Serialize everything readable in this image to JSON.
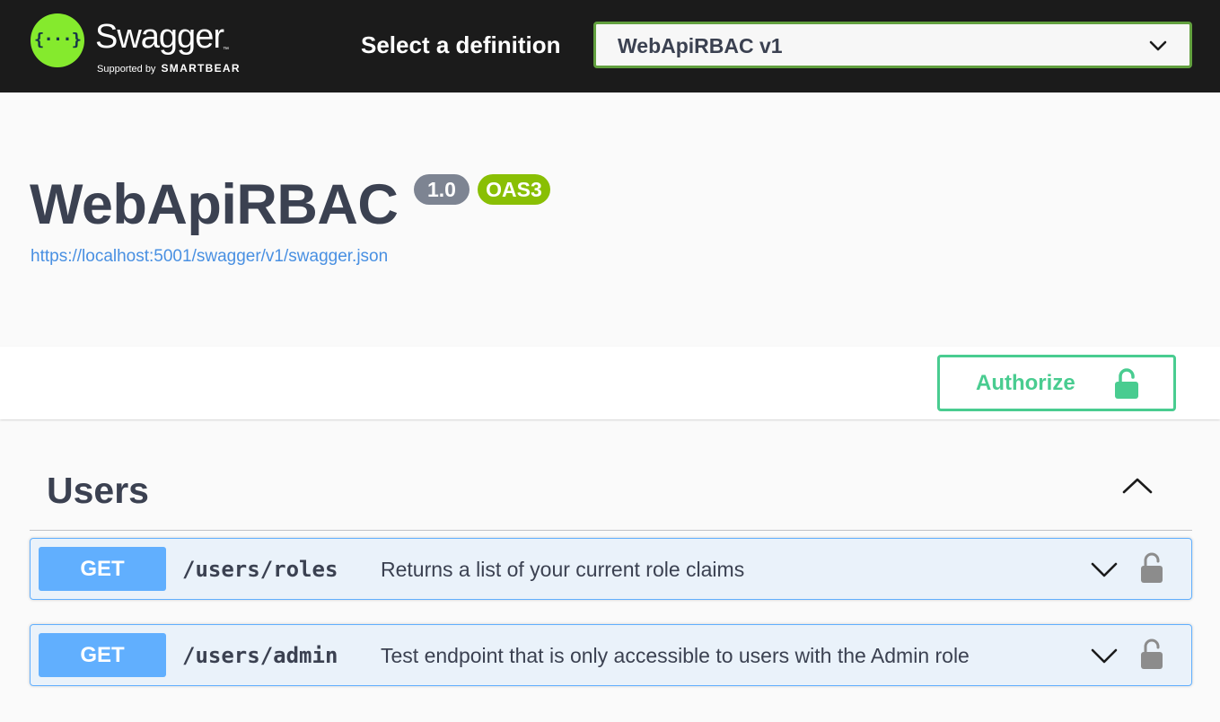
{
  "topbar": {
    "logo_title": "Swagger",
    "logo_tm": "™",
    "logo_braces": "{···}",
    "logo_supported_by": "Supported by",
    "logo_company": "SMARTBEAR",
    "definition_label": "Select a definition",
    "definition_selected": "WebApiRBAC v1"
  },
  "info": {
    "title": "WebApiRBAC",
    "version_badge": "1.0",
    "oas_badge": "OAS3",
    "spec_url": "https://localhost:5001/swagger/v1/swagger.json"
  },
  "auth": {
    "authorize_label": "Authorize"
  },
  "tags": [
    {
      "name": "Users",
      "expanded": true,
      "operations": [
        {
          "method": "GET",
          "path": "/users/roles",
          "summary": "Returns a list of your current role claims",
          "locked": false
        },
        {
          "method": "GET",
          "path": "/users/admin",
          "summary": "Test endpoint that is only accessible to users with the Admin role",
          "locked": false
        }
      ]
    }
  ],
  "colors": {
    "topbar_bg": "#1b1b1b",
    "logo_green": "#85ea2d",
    "select_border": "#62a03f",
    "authorize_green": "#49cc90",
    "get_blue": "#61affe",
    "version_badge": "#7d8492",
    "oas_badge": "#89bf04",
    "link_blue": "#4990e2"
  },
  "icons": {
    "select_chevron": "chevron-down-icon",
    "authorize": "unlocked-padlock-icon",
    "tag_toggle": "chevron-up-icon",
    "operation_expand": "chevron-down-icon",
    "operation_lock": "unlocked-padlock-icon"
  }
}
